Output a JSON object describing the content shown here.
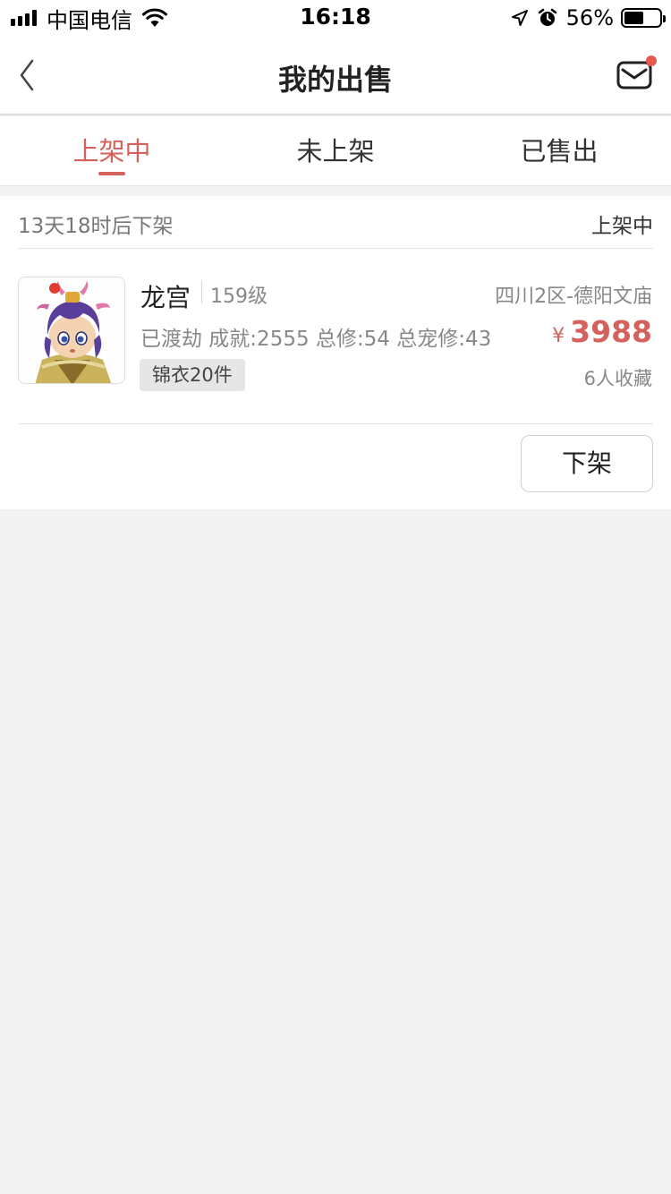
{
  "status_bar": {
    "carrier": "中国电信",
    "time": "16:18",
    "battery_percent": "56%",
    "battery_level": 0.56
  },
  "nav": {
    "title": "我的出售",
    "back_icon": "chevron-left-icon",
    "message_icon": "mail-icon",
    "has_unread": true
  },
  "tabs": [
    {
      "label": "上架中",
      "active": true
    },
    {
      "label": "未上架",
      "active": false
    },
    {
      "label": "已售出",
      "active": false
    }
  ],
  "listing": {
    "countdown": "13天18时后下架",
    "status": "上架中",
    "role_name": "龙宫",
    "level": "159级",
    "server": "四川2区-德阳文庙",
    "stats": "已渡劫 成就:2555 总修:54 总宠修:43",
    "currency": "¥",
    "price": "3988",
    "tag": "锦衣20件",
    "favorites": "6人收藏",
    "delist_label": "下架"
  },
  "colors": {
    "accent": "#d4615c",
    "background": "#f3f3f3",
    "unread_dot": "#e8584d"
  }
}
